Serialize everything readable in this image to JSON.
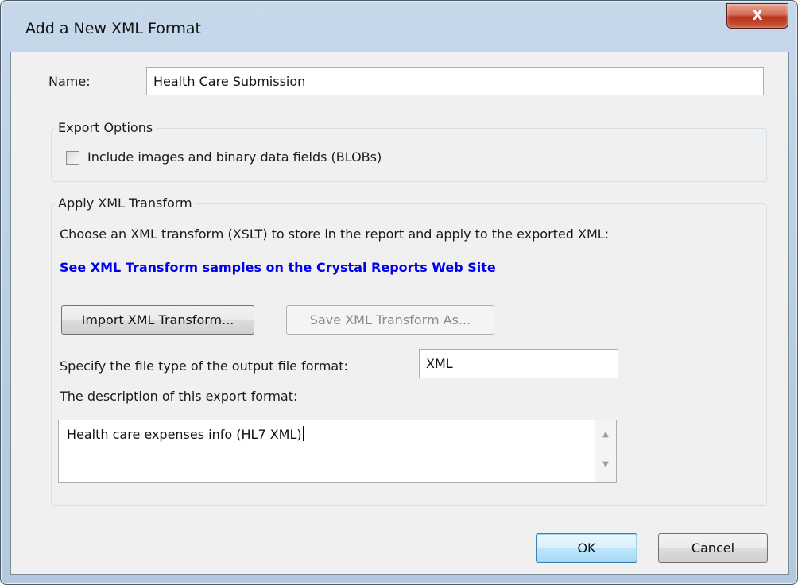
{
  "dialog": {
    "title": "Add a New XML Format",
    "close_label": "X"
  },
  "background": {
    "fragment_char": "a"
  },
  "name_field": {
    "label": "Name:",
    "value": "Health Care Submission"
  },
  "export_options": {
    "group_title": "Export Options",
    "include_blobs_label": "Include images and binary data fields (BLOBs)",
    "include_blobs_checked": false
  },
  "xml_transform": {
    "group_title": "Apply XML Transform",
    "instruction": "Choose an XML transform (XSLT) to store in the report and apply to the exported XML:",
    "samples_link": "See XML Transform samples on the Crystal Reports Web Site",
    "import_button": "Import XML Transform...",
    "save_button": "Save XML Transform As...",
    "file_type_label": "Specify the file type of the output file format:",
    "file_type_value": "XML",
    "description_label": "The description of this export format:",
    "description_value": "Health care expenses info (HL7 XML)"
  },
  "footer": {
    "ok_label": "OK",
    "cancel_label": "Cancel"
  },
  "colors": {
    "link": "#0000ee",
    "close_button": "#c8442a",
    "frame": "#b9cde2"
  }
}
